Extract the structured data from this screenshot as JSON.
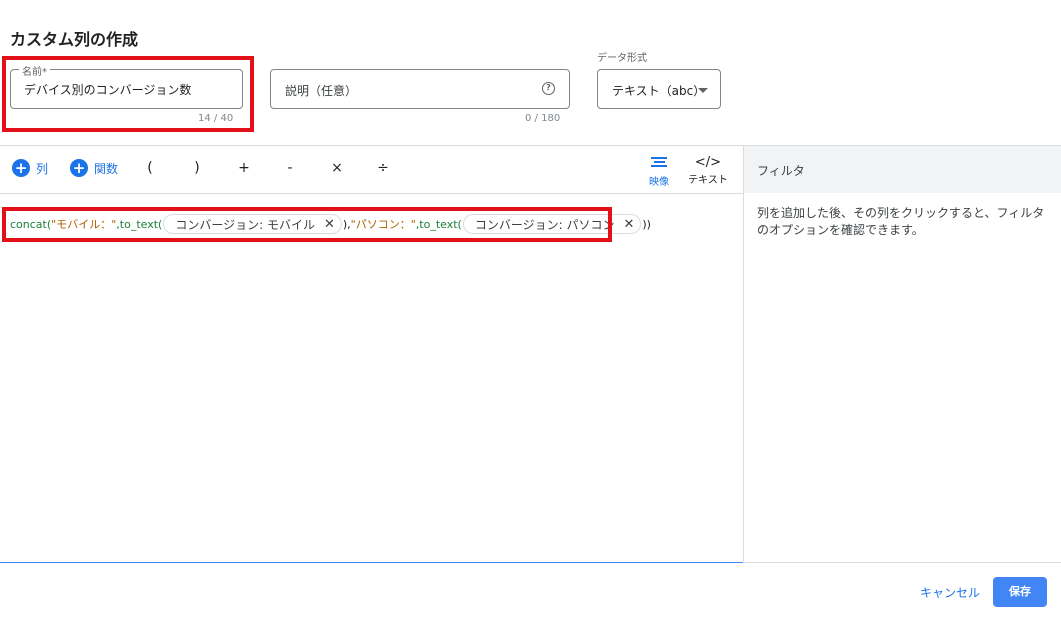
{
  "dialog": {
    "title": "カスタム列の作成"
  },
  "name_field": {
    "label": "名前*",
    "value": "デバイス別のコンバージョン数",
    "counter": "14 / 40"
  },
  "description_field": {
    "placeholder": "説明（任意）",
    "counter": "0 / 180",
    "icon": "help-icon"
  },
  "data_type": {
    "label": "データ形式",
    "selected": "テキスト（abc）"
  },
  "toolbar": {
    "column_label": "列",
    "function_label": "関数",
    "operators": [
      "(",
      ")",
      "+",
      "-",
      "×",
      "÷"
    ],
    "visual_label": "映像",
    "text_label": "テキスト",
    "visual_icon": "lines-icon",
    "text_icon": "code-icon"
  },
  "formula": {
    "part1": "concat(",
    "part2": "\"モバイル：\"",
    "part3": ",to_text(",
    "chip1": "コンバージョン: モバイル",
    "part4": "),",
    "part5": "\"パソコン：\"",
    "part6": ",to_text(",
    "chip2": "コンバージョン: パソコン",
    "part7": "))"
  },
  "filter_panel": {
    "title": "フィルタ",
    "description": "列を追加した後、その列をクリックすると、フィルタのオプションを確認できます。"
  },
  "footer": {
    "cancel_label": "キャンセル",
    "save_label": "保存"
  },
  "colors": {
    "accent": "#1a73e8",
    "highlight_box": "#e3101a",
    "save_button": "#4285f4"
  }
}
